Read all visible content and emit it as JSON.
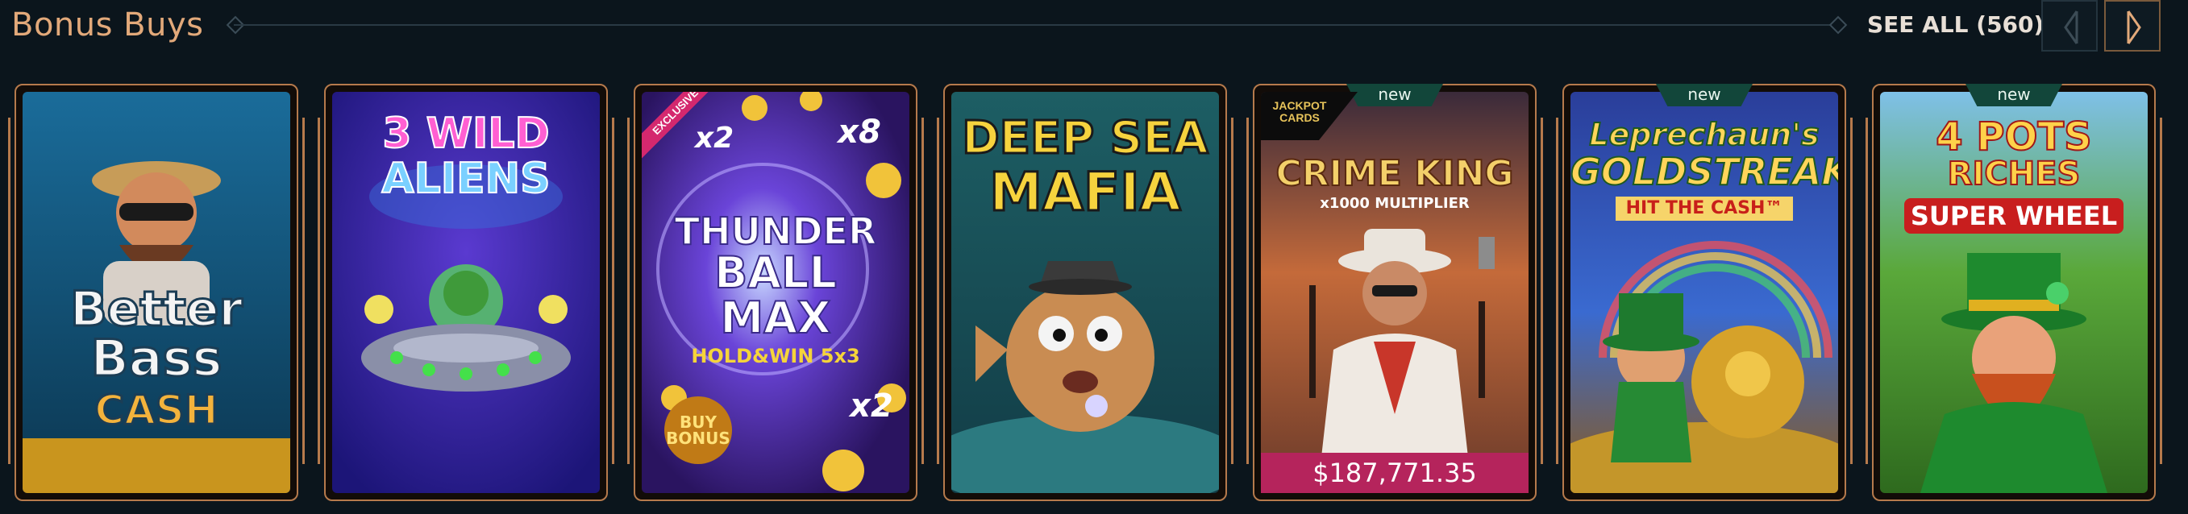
{
  "section": {
    "title": "Bonus Buys",
    "see_all_label": "SEE ALL (560)"
  },
  "nav": {
    "prev_icon": "chevron-left-icon",
    "next_icon": "chevron-right-icon"
  },
  "games": [
    {
      "name": "Better Bass Cash",
      "title_lines": [
        "Better",
        "Bass",
        "CASH"
      ],
      "badge": ""
    },
    {
      "name": "3 Wild Aliens",
      "title_lines": [
        "3 WILD",
        "ALIENS"
      ],
      "badge": ""
    },
    {
      "name": "Thunder Ball Max",
      "title_lines": [
        "THUNDER",
        "BALL",
        "MAX",
        "HOLD&WIN 5x3"
      ],
      "ribbon": "EXCLUSIVE",
      "extra": [
        "x2",
        "x8",
        "x2",
        "BUY BONUS"
      ],
      "badge": ""
    },
    {
      "name": "Deep Sea Mafia",
      "title_lines": [
        "DEEP SEA",
        "MAFIA"
      ],
      "badge": ""
    },
    {
      "name": "Crime King",
      "title_lines": [
        "CRIME KING",
        "x1000 MULTIPLIER"
      ],
      "logo": "JACKPOT CARDS",
      "badge": "new",
      "jackpot": "$187,771.35"
    },
    {
      "name": "Leprechaun's Goldstreak",
      "title_lines": [
        "Leprechaun's",
        "GOLDSTREAK",
        "HIT THE CASH™"
      ],
      "badge": "new"
    },
    {
      "name": "4 Pots Riches Super Wheel",
      "title_lines": [
        "4 POTS",
        "RICHES",
        "SUPER WHEEL"
      ],
      "badge": "new"
    }
  ],
  "colors": {
    "accent": "#e2a97a",
    "card_border": "#b67a4c",
    "new_tag": "#12463a",
    "jackpot_bar": "#b5245c"
  }
}
